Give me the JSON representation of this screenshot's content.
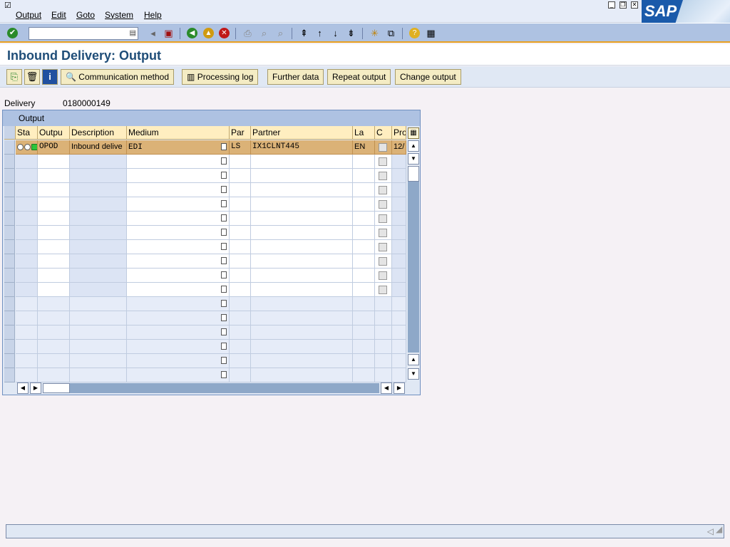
{
  "menubar": {
    "items": [
      {
        "label": "Output"
      },
      {
        "label": "Edit"
      },
      {
        "label": "Goto"
      },
      {
        "label": "System"
      },
      {
        "label": "Help"
      }
    ]
  },
  "logo": {
    "text": "SAP"
  },
  "toolbar": {
    "command_value": "",
    "icons": [
      "enter-icon",
      "command-dropdown-icon",
      "back-arrow-icon",
      "save-icon",
      "back-icon",
      "exit-icon",
      "cancel-icon",
      "print-icon",
      "find-icon",
      "find-next-icon",
      "first-page-icon",
      "previous-page-icon",
      "next-page-icon",
      "last-page-icon",
      "create-session-icon",
      "shortcut-icon",
      "help-icon",
      "layout-icon"
    ]
  },
  "page": {
    "title": "Inbound Delivery: Output"
  },
  "app_toolbar": {
    "communication_method": "Communication method",
    "processing_log": "Processing log",
    "further_data": "Further data",
    "repeat_output": "Repeat output",
    "change_output": "Change output"
  },
  "header": {
    "delivery_label": "Delivery",
    "delivery_value": "0180000149"
  },
  "grid": {
    "title": "Output",
    "columns": [
      "Sta",
      "Outpu",
      "Description",
      "Medium",
      "Par",
      "Partner",
      "La",
      "C",
      "Pro"
    ],
    "rows": [
      {
        "output": "OPOD",
        "description": "Inbound delive",
        "medium": "EDI",
        "partner_func": "LS",
        "partner": "IX1CLNT445",
        "language": "EN",
        "pro": "12/"
      }
    ],
    "empty_editable_rows": 10,
    "empty_readonly_rows": 6
  },
  "colors": {
    "selected_row": "#dbb277",
    "header_bg": "#ffeec0",
    "title": "#1f4d78",
    "toolbar_bg": "#aec2e2"
  }
}
